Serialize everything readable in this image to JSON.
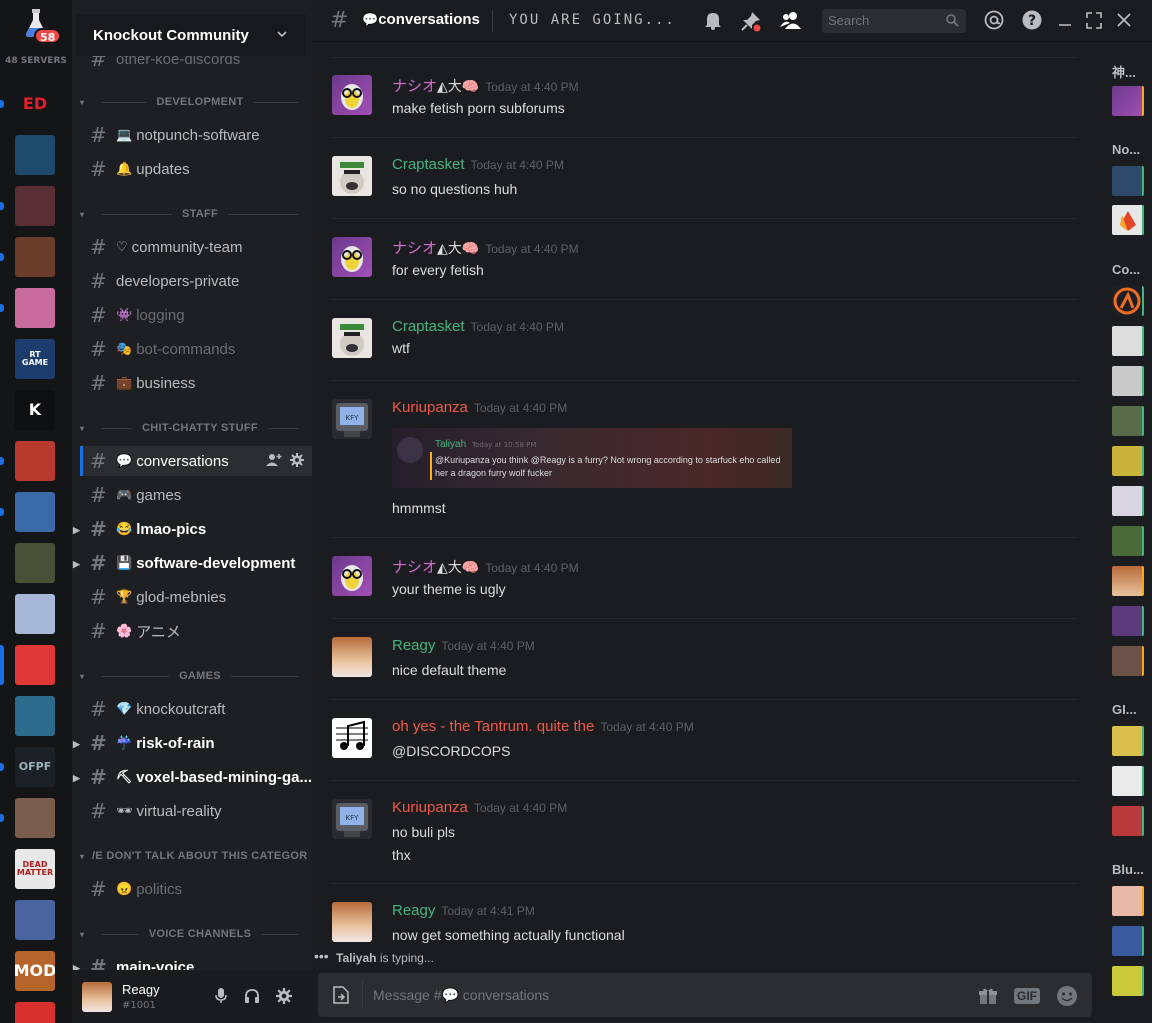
{
  "rail": {
    "home_badge": "58",
    "servers_count": "48 SERVERS",
    "servers": [
      {
        "label": "ED",
        "bg": "#141517",
        "fg": "#e0202a"
      },
      {
        "label": "",
        "bg": "#1e4a6b",
        "fg": "#ffffff"
      },
      {
        "label": "",
        "bg": "#5a2e35",
        "fg": "#ffffff"
      },
      {
        "label": "",
        "bg": "#6a3d2a",
        "fg": "#ffffff"
      },
      {
        "label": "",
        "bg": "#c66b9b",
        "fg": "#ffffff"
      },
      {
        "label": "RT GAME",
        "bg": "#1c3c6e",
        "fg": "#ffffff"
      },
      {
        "label": "K",
        "bg": "#0e0f11",
        "fg": "#ffffff"
      },
      {
        "label": "",
        "bg": "#b83a2f",
        "fg": "#ffffff"
      },
      {
        "label": "",
        "bg": "#3b6aa8",
        "fg": "#ffffff"
      },
      {
        "label": "",
        "bg": "#4a5038",
        "fg": "#ffffff"
      },
      {
        "label": "",
        "bg": "#a7b7d8",
        "fg": "#ffffff"
      },
      {
        "label": "",
        "bg": "#e03838",
        "fg": "#ffffff"
      },
      {
        "label": "",
        "bg": "#2c6b8c",
        "fg": "#ffffff"
      },
      {
        "label": "OFPF",
        "bg": "#1b2126",
        "fg": "#9fb0bb"
      },
      {
        "label": "",
        "bg": "#7a5c4c",
        "fg": "#ffffff"
      },
      {
        "label": "DEAD MATTER",
        "bg": "#e8e8e8",
        "fg": "#b01e1e"
      },
      {
        "label": "",
        "bg": "#4a64a0",
        "fg": "#ffffff"
      },
      {
        "label": "MOD",
        "bg": "#b5642a",
        "fg": "#ffffff"
      },
      {
        "label": "",
        "bg": "#d82f2f",
        "fg": "#ffffff"
      }
    ]
  },
  "guild": {
    "name": "Knockout Community"
  },
  "categories": {
    "development": "DEVELOPMENT",
    "staff": "STAFF",
    "chit": "CHIT-CHATTY STUFF",
    "games": "GAMES",
    "dont_talk": "/E DON'T TALK ABOUT THIS CATEGOR",
    "voice": "VOICE CHANNELS"
  },
  "channels": {
    "other_koe": "other-koe-discords",
    "notpunch": "notpunch-software",
    "updates": "updates",
    "community_team": "community-team",
    "developers_private": "developers-private",
    "logging": "logging",
    "bot_commands": "bot-commands",
    "business": "business",
    "conversations": "conversations",
    "games": "games",
    "lmao_pics": "lmao-pics",
    "software_dev": "software-development",
    "glod": "glod-mebnies",
    "anime": "アニメ",
    "knockoutcraft": "knockoutcraft",
    "risk_of_rain": "risk-of-rain",
    "voxel": "voxel-based-mining-ga...",
    "vr": "virtual-reality",
    "politics": "politics",
    "main_voice": "main-voice"
  },
  "user": {
    "name": "Reagy",
    "tag": "#1001"
  },
  "topbar": {
    "channel": "conversations",
    "topic": "YOU ARE GOING...",
    "search_placeholder": "Search"
  },
  "messages": [
    {
      "author": "ナシオ",
      "color": "#d66bd4",
      "time": "Today at 4:40 PM",
      "lines": [
        "make fetish porn subforums"
      ]
    },
    {
      "author": "Craptasket",
      "color": "#43b581",
      "time": "Today at 4:40 PM",
      "lines": [
        "so no questions huh"
      ]
    },
    {
      "author": "ナシオ",
      "color": "#d66bd4",
      "time": "Today at 4:40 PM",
      "lines": [
        "for every fetish"
      ]
    },
    {
      "author": "Craptasket",
      "color": "#43b581",
      "time": "Today at 4:40 PM",
      "lines": [
        "wtf"
      ]
    },
    {
      "author": "Kuriupanza",
      "color": "#f05a4a",
      "time": "Today at 4:40 PM",
      "lines": [
        "hmmmst"
      ]
    },
    {
      "author": "ナシオ",
      "color": "#d66bd4",
      "time": "Today at 4:40 PM",
      "lines": [
        "your theme is ugly"
      ]
    },
    {
      "author": "Reagy",
      "color": "#43b581",
      "time": "Today at 4:40 PM",
      "lines": [
        "nice default theme"
      ]
    },
    {
      "author": "oh yes - the Tantrum. quite the",
      "color": "#f05a4a",
      "time": "Today at 4:40 PM",
      "lines": [
        "@DISCORDCOPS"
      ]
    },
    {
      "author": "Kuriupanza",
      "color": "#f05a4a",
      "time": "Today at 4:40 PM",
      "lines": [
        "no buli pls",
        "thx"
      ]
    },
    {
      "author": "Reagy",
      "color": "#43b581",
      "time": "Today at 4:41 PM",
      "lines": [
        "now get something actually functional"
      ]
    }
  ],
  "embed": {
    "name": "Taliyah",
    "time": "Today at 10:58 PM",
    "text": "@Kuriupanza you think @Reagy is a furry? Not wrong according to starfuck eho called her a dragon furry wolf fucker"
  },
  "typing": {
    "user": "Taliyah",
    "suffix": "is typing..."
  },
  "composer": {
    "placeholder": "Message #💬 conversations",
    "gif": "GIF"
  },
  "members": {
    "groups": [
      "神...",
      "No...",
      "Co...",
      "GI...",
      "Blu..."
    ]
  }
}
